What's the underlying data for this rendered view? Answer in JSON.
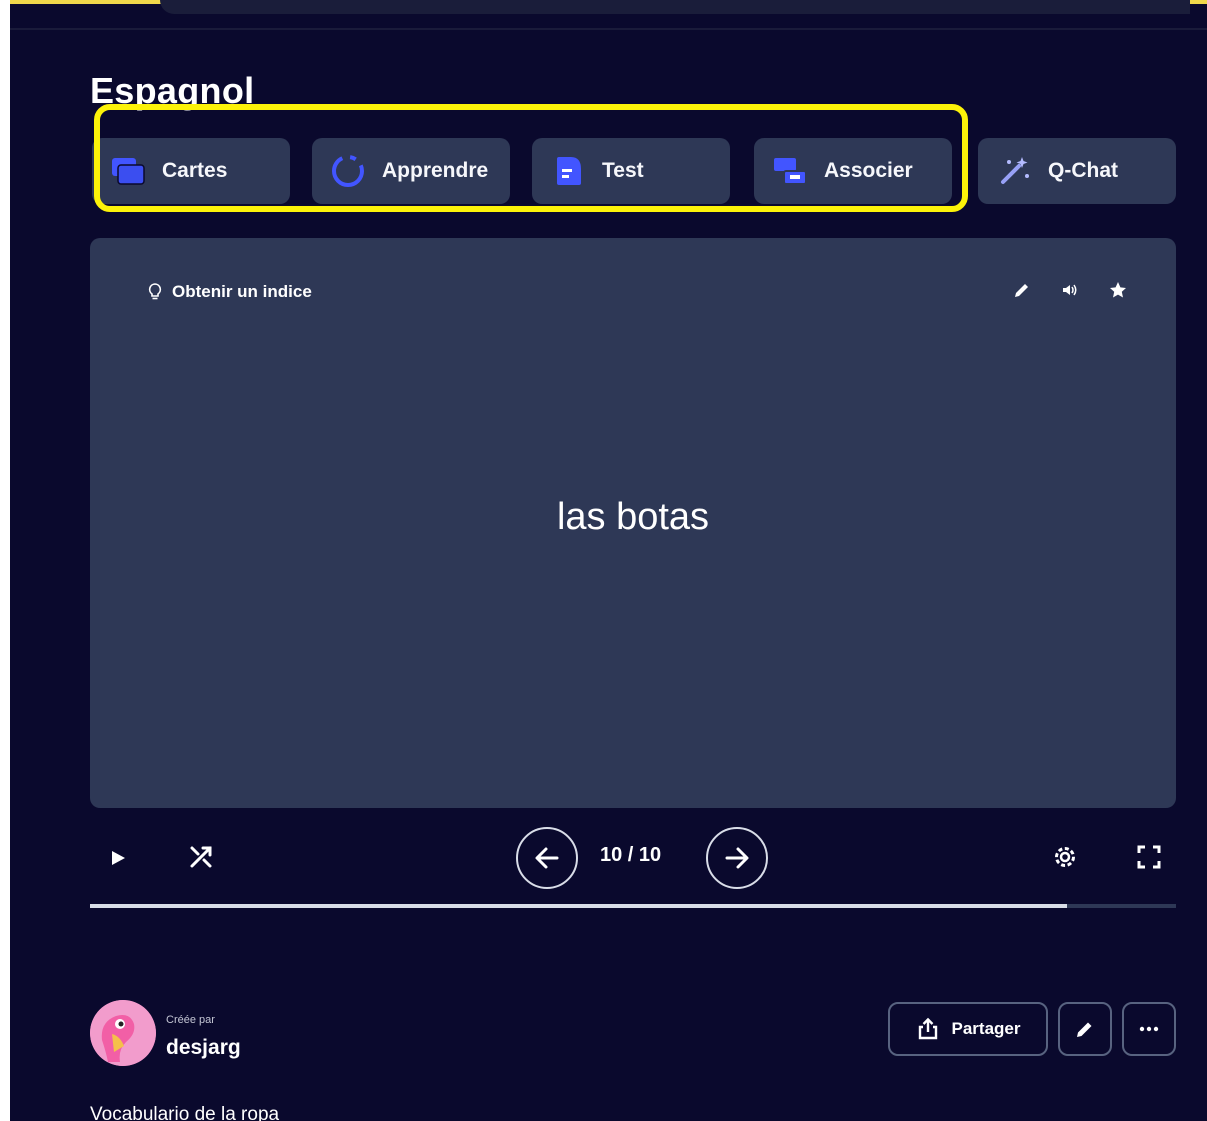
{
  "set": {
    "title": "Espagnol",
    "description": "Vocabulario de la ropa"
  },
  "modes": [
    {
      "label": "Cartes",
      "icon": "flashcards-icon"
    },
    {
      "label": "Apprendre",
      "icon": "learn-icon"
    },
    {
      "label": "Test",
      "icon": "test-icon"
    },
    {
      "label": "Associer",
      "icon": "match-icon"
    },
    {
      "label": "Q-Chat",
      "icon": "magic-wand-icon"
    }
  ],
  "card": {
    "hint_label": "Obtenir un indice",
    "term": "las botas",
    "actions": [
      "edit-icon",
      "audio-icon",
      "star-icon"
    ]
  },
  "controls": {
    "counter": "10 / 10",
    "progress": 0.9
  },
  "creator": {
    "created_by_label": "Créée par",
    "username": "desjarg"
  },
  "actions": {
    "share_label": "Partager"
  },
  "colors": {
    "background": "#0a092d",
    "card": "#2e3856",
    "highlight": "#fcf209",
    "accent_blue": "#4255ff"
  }
}
